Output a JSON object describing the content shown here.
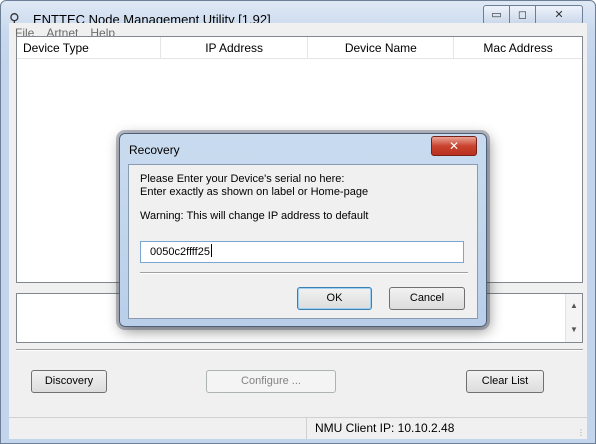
{
  "window": {
    "title": "ENTTEC  Node Management Utility [1.92]",
    "controls": {
      "minimize": "▭",
      "maximize": "◻",
      "close": "✕"
    }
  },
  "menu": [
    "File",
    "Artnet",
    "Help"
  ],
  "device_list": {
    "columns": [
      "Device Type",
      "IP Address",
      "Device Name",
      "Mac Address"
    ],
    "rows": []
  },
  "log": {
    "text": ""
  },
  "buttons": {
    "discovery": "Discovery",
    "configure": "Configure ...",
    "clear_list": "Clear List"
  },
  "status": {
    "left": "",
    "client_ip": "NMU Client IP: 10.10.2.48"
  },
  "dialog": {
    "title": "Recovery",
    "close_glyph": "✕",
    "line1": "Please Enter your Device's serial no  here:",
    "line2": "Enter exactly as shown on label or Home-page",
    "warning": "Warning: This will change IP address to default",
    "serial_value": "0050c2ffff25",
    "ok_label": "OK",
    "cancel_label": "Cancel"
  },
  "icons": {
    "app": "plug-icon",
    "scroll_up": "▲",
    "scroll_down": "▼"
  },
  "colors": {
    "titlebar": "#c9d9ee",
    "dialog_close": "#c9432f",
    "input_border": "#7aa6d6"
  }
}
